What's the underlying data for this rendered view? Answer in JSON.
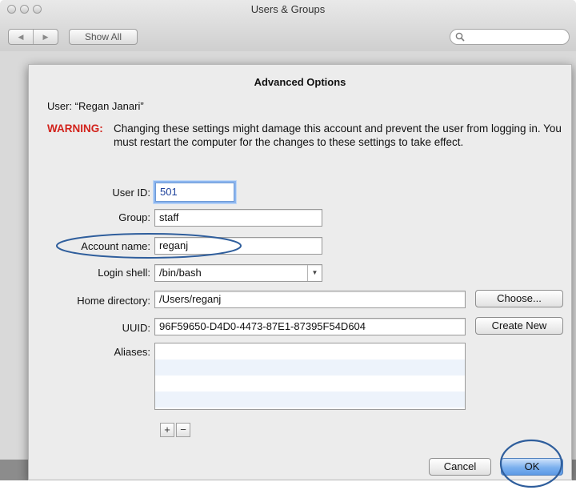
{
  "window": {
    "title": "Users & Groups"
  },
  "toolbar": {
    "back": "◀",
    "forward": "▶",
    "show_all": "Show All"
  },
  "search": {
    "placeholder": ""
  },
  "dialog": {
    "title": "Advanced Options",
    "user": "User: “Regan Janari”",
    "warning_label": "WARNING:",
    "warning_text": "Changing these settings might damage this account and prevent the user from logging in. You must restart the computer for the changes to these settings to take effect.",
    "fields": {
      "user_id": {
        "label": "User ID:",
        "value": "501"
      },
      "group": {
        "label": "Group:",
        "value": "staff"
      },
      "account_name": {
        "label": "Account name:",
        "value": "reganj"
      },
      "login_shell": {
        "label": "Login shell:",
        "value": "/bin/bash"
      },
      "home_directory": {
        "label": "Home directory:",
        "value": "/Users/reganj"
      },
      "uuid": {
        "label": "UUID:",
        "value": "96F59650-D4D0-4473-87E1-87395F54D604"
      },
      "aliases": {
        "label": "Aliases:"
      }
    },
    "buttons": {
      "choose": "Choose...",
      "create_new": "Create New",
      "add": "+",
      "remove": "−",
      "cancel": "Cancel",
      "ok": "OK"
    }
  },
  "colors": {
    "warning": "#d2231c",
    "annotation": "#2f5e9c",
    "focus": "#8db6ef"
  }
}
